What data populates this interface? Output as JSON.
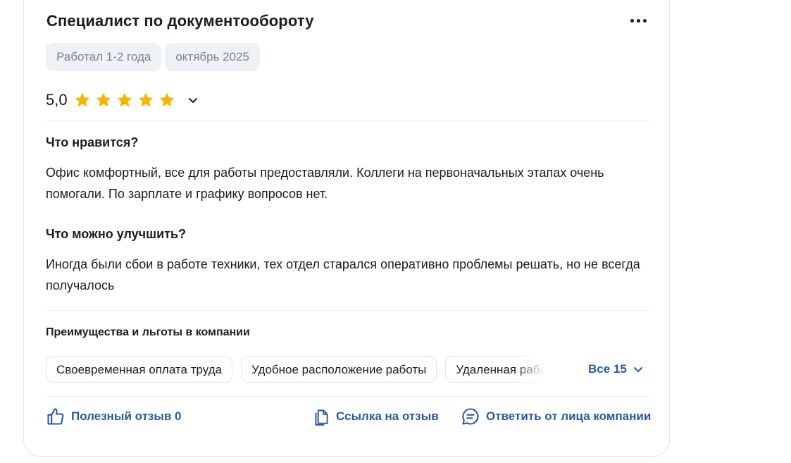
{
  "review": {
    "title": "Специалист по документообороту",
    "tags": [
      "Работал 1-2 года",
      "октябрь 2025"
    ],
    "rating": {
      "value": "5,0",
      "stars": 5,
      "star_color": "#f7b500"
    },
    "likes": {
      "title": "Что нравится?",
      "text": "Офис комфортный, все для работы предоставляли. Коллеги на первоначальных этапах очень помогали. По зарплате и графику вопросов нет."
    },
    "improve": {
      "title": "Что можно улучшить?",
      "text": "Иногда были сбои в работе техники, тех отдел старался оперативно проблемы решать, но не всегда получалось"
    }
  },
  "benefits": {
    "title": "Преимущества и льготы в компании",
    "items": [
      "Своевременная оплата труда",
      "Удобное расположение работы",
      "Удаленная работа"
    ],
    "all_label": "Все 15"
  },
  "actions": {
    "helpful": "Полезный отзыв 0",
    "link": "Ссылка на отзыв",
    "reply": "Ответить от лица компании"
  },
  "colors": {
    "accent": "#2a58a0",
    "tag_bg": "#eef1f6",
    "tag_text": "#7a8494",
    "star": "#f7b500"
  },
  "icons": [
    "more-icon",
    "star-icon",
    "chevron-down-icon",
    "thumbs-up-icon",
    "copy-link-icon",
    "chat-icon"
  ]
}
